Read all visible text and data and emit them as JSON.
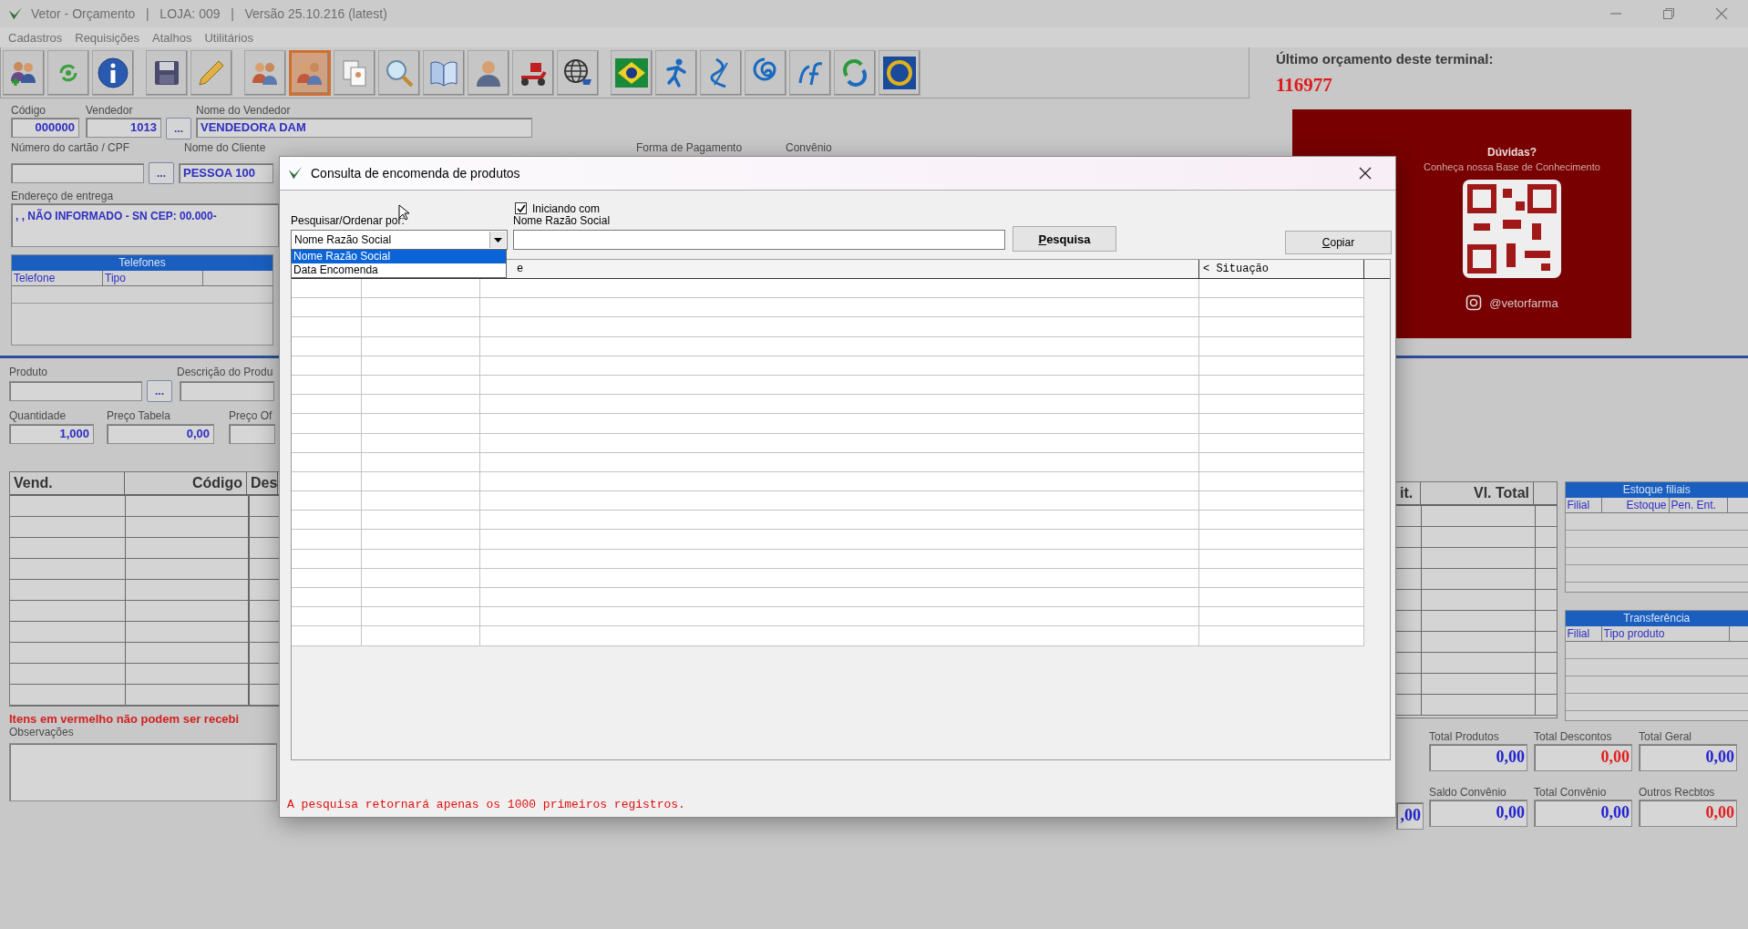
{
  "window": {
    "title": "Vetor - Orçamento   |   LOJA: 009   |   Versão 25.10.216 (latest)"
  },
  "menu": [
    "Cadastros",
    "Requisições",
    "Atalhos",
    "Utilitários"
  ],
  "toolbar": [
    {
      "buttons": [
        {
          "kind": "people-add",
          "selected": false
        },
        {
          "kind": "refresh",
          "selected": false
        },
        {
          "kind": "info",
          "selected": false
        }
      ]
    },
    {
      "buttons": [
        {
          "kind": "save",
          "selected": false
        },
        {
          "kind": "pencil",
          "selected": false
        }
      ]
    },
    {
      "buttons": [
        {
          "kind": "people",
          "selected": false
        },
        {
          "kind": "people",
          "selected": true
        },
        {
          "kind": "documents",
          "selected": false
        },
        {
          "kind": "search",
          "selected": false
        },
        {
          "kind": "book",
          "selected": false
        },
        {
          "kind": "person",
          "selected": false
        },
        {
          "kind": "delivery",
          "selected": false
        },
        {
          "kind": "globe",
          "selected": false
        }
      ]
    },
    {
      "buttons": [
        {
          "kind": "flag",
          "selected": false
        },
        {
          "kind": "runner",
          "selected": false
        },
        {
          "kind": "helix",
          "selected": false
        },
        {
          "kind": "spiral",
          "selected": false
        },
        {
          "kind": "letter-f",
          "selected": false
        },
        {
          "kind": "arrows",
          "selected": false
        },
        {
          "kind": "ring",
          "selected": false
        }
      ]
    }
  ],
  "order": {
    "codigo": {
      "label": "Código",
      "value": "000000"
    },
    "vendedor": {
      "label": "Vendedor",
      "value": "1013",
      "lookup_button": "..."
    },
    "nome_vendedor": {
      "label": "Nome do Vendedor",
      "value": "VENDEDORA DAM"
    },
    "cartao": {
      "label": "Número do cartão / CPF",
      "lookup_button": "..."
    },
    "nome_cliente": {
      "label": "Nome do Cliente",
      "value": "PESSOA 100"
    },
    "forma_pagamento": {
      "label": "Forma de Pagamento"
    },
    "convenio": {
      "label": "Convênio"
    },
    "endereco": {
      "label": "Endereço de entrega",
      "value": ", , NÃO INFORMADO - SN CEP: 00.000-"
    }
  },
  "last_quote": {
    "label": "Último orçamento deste terminal:",
    "value": "116977"
  },
  "help_banner": {
    "title": "Dúvidas?",
    "subtitle": "Conheça nossa Base de Conhecimento",
    "handle": "@vetorfarma"
  },
  "phones": {
    "title": "Telefones",
    "columns": [
      "Telefone",
      "Tipo"
    ]
  },
  "product": {
    "produto": {
      "label": "Produto",
      "lookup_button": "..."
    },
    "descricao": {
      "label": "Descrição do Produ"
    },
    "quantidade": {
      "label": "Quantidade",
      "value": "1,000"
    },
    "preco_tabela": {
      "label": "Preço Tabela",
      "value": "0,00"
    },
    "preco_oferta": {
      "label": "Preço Of"
    }
  },
  "items": {
    "columns_left": [
      "Vend.",
      "Código",
      "Des"
    ],
    "columns_right": [
      "it.",
      "Vl. Total"
    ]
  },
  "items_note": "Itens em vermelho não podem ser recebi",
  "observations": {
    "label": "Observações"
  },
  "stock_panel": {
    "title": "Estoque filiais",
    "columns": [
      "Filial",
      "Estoque",
      "Pen. Ent."
    ]
  },
  "transfer_panel": {
    "title": "Transferência",
    "columns": [
      "Filial",
      "Tipo produto"
    ]
  },
  "partial_total": ",00",
  "totals": [
    {
      "label": "Total Produtos",
      "value": "0,00",
      "color": "#2424d0"
    },
    {
      "label": "Total Descontos",
      "value": "0,00",
      "color": "#e02020"
    },
    {
      "label": "Total Geral",
      "value": "0,00",
      "color": "#2424d0"
    },
    {
      "label": "Saldo Convênio",
      "value": "0,00",
      "color": "#2424d0"
    },
    {
      "label": "Total Convênio",
      "value": "0,00",
      "color": "#2424d0"
    },
    {
      "label": "Outros Recbtos",
      "value": "0,00",
      "color": "#e02020"
    }
  ],
  "dialog": {
    "title": "Consulta de encomenda de produtos",
    "search_by": {
      "label": "Pesquisar/Ordenar por:",
      "value": "Nome Razão Social",
      "expanded": true,
      "options": [
        {
          "label": "Nome Razão Social",
          "selected": true
        },
        {
          "label": "Data Encomenda",
          "selected": false
        }
      ]
    },
    "starts_with": {
      "label": "Iniciando com",
      "checked": true
    },
    "query": {
      "label": "Nome Razão Social"
    },
    "search_button": "Pesquisa",
    "copy_button": "Copiar",
    "table": {
      "columns": [
        {
          "kind": "blank"
        },
        {
          "kind": "blank"
        },
        {
          "kind": "text",
          "label": "e"
        },
        {
          "kind": "text",
          "label": "< Situação"
        }
      ]
    },
    "note": "A pesquisa retornará apenas os 1000 primeiros registros."
  }
}
